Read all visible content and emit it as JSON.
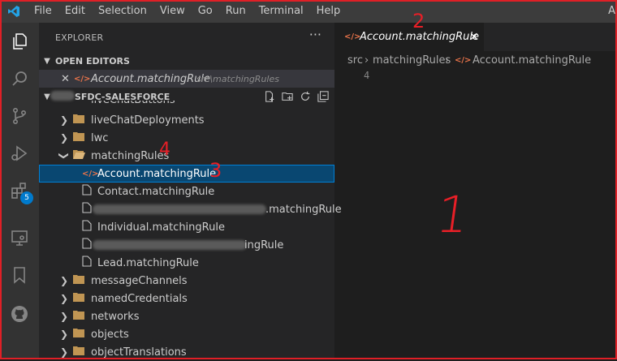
{
  "menu": [
    "File",
    "Edit",
    "Selection",
    "View",
    "Go",
    "Run",
    "Terminal",
    "Help"
  ],
  "menu_right": "A",
  "activity_badge": "5",
  "explorer": {
    "title": "EXPLORER",
    "more": "···",
    "open_editors_label": "OPEN EDITORS",
    "open_editor": {
      "name": "Account.matchingRule",
      "path": "src\\matchingRules"
    },
    "project_label": "SFDC-SALESFORCE",
    "partial_top": "liveChatButtons",
    "folders_before": [
      "liveChatDeployments",
      "lwc"
    ],
    "open_folder": "matchingRules",
    "files": [
      {
        "name": "Account.matchingRule",
        "selected": true
      },
      {
        "name": "Contact.matchingRule"
      },
      {
        "name": ".matchingRule",
        "redacted": true
      },
      {
        "name": "Individual.matchingRule"
      },
      {
        "name": "ingRule",
        "redacted": true
      },
      {
        "name": "Lead.matchingRule"
      }
    ],
    "folders_after": [
      "messageChannels",
      "namedCredentials",
      "networks",
      "objects",
      "objectTranslations"
    ]
  },
  "editor": {
    "tab_label": "Account.matchingRule",
    "breadcrumb": [
      "src",
      "matchingRules",
      "Account.matchingRule"
    ],
    "line_number": "4"
  },
  "annotations": {
    "one": "1",
    "two": "2",
    "three": "3",
    "four": "4"
  },
  "colors": {
    "accent_red": "#e01f26",
    "selection": "#094771",
    "folder": "#c09553",
    "xml_icon": "#e8734a"
  }
}
